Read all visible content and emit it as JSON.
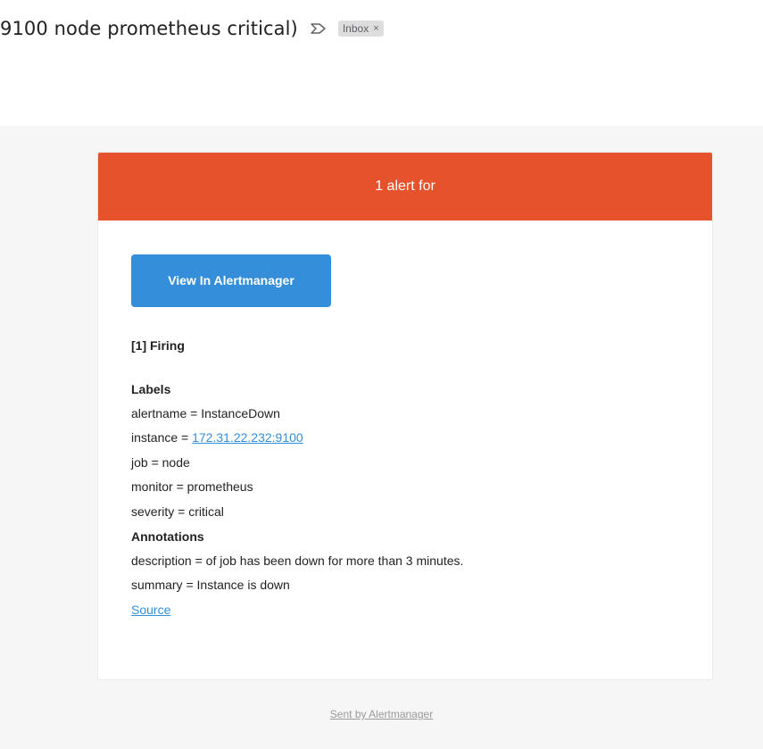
{
  "email": {
    "subject": "9100 node prometheus critical)",
    "label_chip": "Inbox",
    "label_chip_close": "×"
  },
  "alert": {
    "header": "1 alert for",
    "button_label": "View In Alertmanager",
    "firing_title": "[1] Firing",
    "labels_title": "Labels",
    "labels": {
      "alertname": "alertname = InstanceDown",
      "instance_prefix": "instance = ",
      "instance_value": "172.31.22.232:9100",
      "job": "job = node",
      "monitor": "monitor = prometheus",
      "severity": "severity = critical"
    },
    "annotations_title": "Annotations",
    "annotations": {
      "description": "description = of job has been down for more than 3 minutes.",
      "summary": "summary = Instance is down"
    },
    "source_link": "Source"
  },
  "footer": {
    "text": "Sent by Alertmanager"
  },
  "colors": {
    "header_bg": "#e6522c",
    "button_bg": "#348eda",
    "link": "#348eda",
    "page_bg": "#f6f6f6"
  },
  "icons": [
    "importance-marker-icon",
    "close-icon"
  ]
}
